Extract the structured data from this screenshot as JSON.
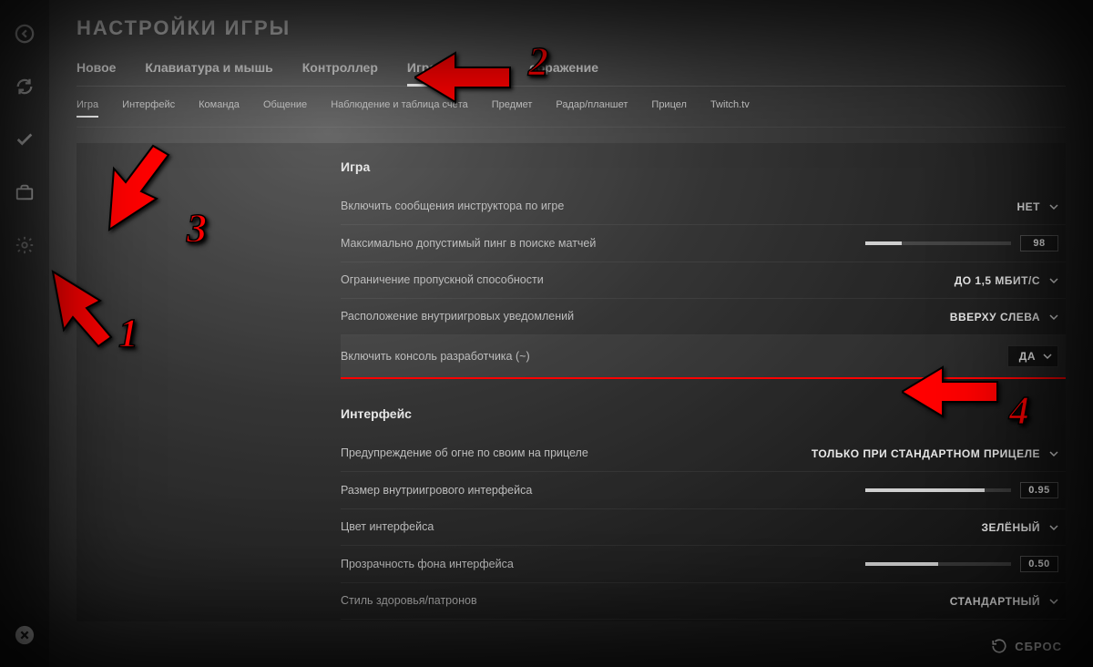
{
  "page_title": "НАСТРОЙКИ ИГРЫ",
  "main_tabs": [
    {
      "label": "Новое",
      "active": false
    },
    {
      "label": "Клавиатура и мышь",
      "active": false
    },
    {
      "label": "Контроллер",
      "active": false
    },
    {
      "label": "Игра",
      "active": true
    },
    {
      "label": "ображение",
      "active": false
    }
  ],
  "sub_tabs": [
    {
      "label": "Игра",
      "active": true
    },
    {
      "label": "Интерфейс",
      "active": false
    },
    {
      "label": "Команда",
      "active": false
    },
    {
      "label": "Общение",
      "active": false
    },
    {
      "label": "Наблюдение и таблица счёта",
      "active": false
    },
    {
      "label": "Предмет",
      "active": false
    },
    {
      "label": "Радар/планшет",
      "active": false
    },
    {
      "label": "Прицел",
      "active": false
    },
    {
      "label": "Twitch.tv",
      "active": false
    }
  ],
  "sections": {
    "game": {
      "title": "Игра",
      "rows": {
        "instructor_messages": {
          "label": "Включить сообщения инструктора по игре",
          "value": "НЕТ"
        },
        "max_ping": {
          "label": "Максимально допустимый пинг в поиске матчей",
          "value": "98",
          "slider_pct": 25
        },
        "bandwidth_limit": {
          "label": "Ограничение пропускной способности",
          "value": "ДО 1,5 МБИТ/С"
        },
        "notif_position": {
          "label": "Расположение внутриигровых уведомлений",
          "value": "ВВЕРХУ СЛЕВА"
        },
        "dev_console": {
          "label": "Включить консоль разработчика (~)",
          "value": "ДА"
        }
      }
    },
    "interface": {
      "title": "Интерфейс",
      "rows": {
        "friendly_fire_warning": {
          "label": "Предупреждение об огне по своим на прицеле",
          "value": "ТОЛЬКО ПРИ СТАНДАРТНОМ ПРИЦЕЛЕ"
        },
        "hud_scale": {
          "label": "Размер внутриигрового интерфейса",
          "value": "0.95",
          "slider_pct": 82
        },
        "hud_color": {
          "label": "Цвет интерфейса",
          "value": "ЗЕЛЁНЫЙ"
        },
        "hud_bg_alpha": {
          "label": "Прозрачность фона интерфейса",
          "value": "0.50",
          "slider_pct": 50
        },
        "health_ammo_style": {
          "label": "Стиль здоровья/патронов",
          "value": "СТАНДАРТНЫЙ"
        }
      }
    }
  },
  "footer": {
    "reset": "СБРОС"
  },
  "annotations": {
    "n1": "1",
    "n2": "2",
    "n3": "3",
    "n4": "4"
  }
}
